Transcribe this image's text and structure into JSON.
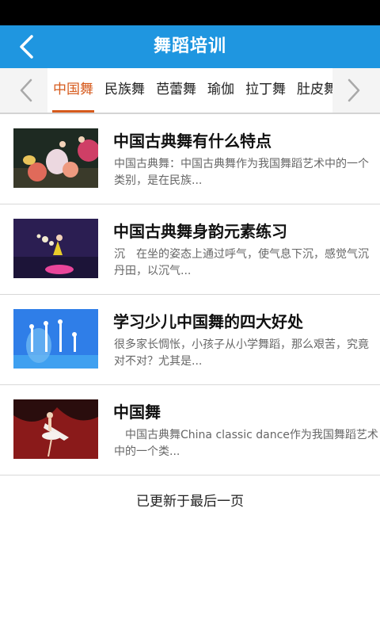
{
  "app_bar": {
    "title": "舞蹈培训",
    "back_icon": "chevron-left-icon"
  },
  "tabs": {
    "prev_icon": "chevron-left-icon",
    "next_icon": "chevron-right-icon",
    "items": [
      {
        "label": "中国舞",
        "active": true
      },
      {
        "label": "民族舞",
        "active": false
      },
      {
        "label": "芭蕾舞",
        "active": false
      },
      {
        "label": "瑜伽",
        "active": false
      },
      {
        "label": "拉丁舞",
        "active": false
      },
      {
        "label": "肚皮舞",
        "active": false
      }
    ]
  },
  "articles": [
    {
      "title": "中国古典舞有什么特点",
      "summary": "中国古典舞：中国古典舞作为我国舞蹈艺术中的一个类别，是在民族..."
    },
    {
      "title": " 中国古典舞身韵元素练习",
      "summary": "沉　在坐的姿态上通过呼气，使气息下沉，感觉气沉丹田，以沉气..."
    },
    {
      "title": "学习少儿中国舞的四大好处",
      "summary": "很多家长惆怅，小孩子从小学舞蹈，那么艰苦，究竟对不对？尤其是..."
    },
    {
      "title": "中国舞",
      "summary": "　中国古典舞China classic dance作为我国舞蹈艺术中的一个类..."
    }
  ],
  "footer": {
    "note": "已更新于最后一页"
  },
  "colors": {
    "app_bar": "#1f96e0",
    "accent": "#d65a1c"
  }
}
